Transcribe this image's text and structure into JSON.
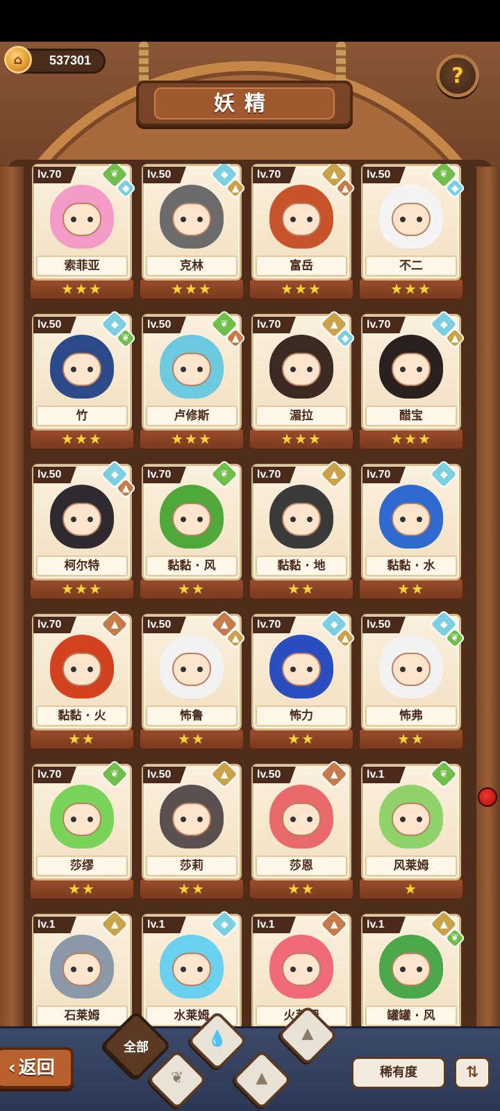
{
  "header": {
    "coins": "537301",
    "title": "妖精",
    "help_icon": "question-leaf-icon"
  },
  "colors": {
    "grass": "#6fbf4a",
    "water": "#7ccfe0",
    "earth": "#c9a24a",
    "fire": "#c57b4a",
    "wind": "#8fd36a"
  },
  "cards": [
    {
      "level": "lv.70",
      "name": "索菲亚",
      "stars": "★★★",
      "element": "grass",
      "sub": "water",
      "hair": "#f39ac6"
    },
    {
      "level": "lv.50",
      "name": "克林",
      "stars": "★★★",
      "element": "water",
      "sub": "earth",
      "hair": "#6b6b6b"
    },
    {
      "level": "lv.70",
      "name": "富岳",
      "stars": "★★★",
      "element": "earth",
      "sub": "fire",
      "hair": "#c7532a"
    },
    {
      "level": "lv.50",
      "name": "不二",
      "stars": "★★★",
      "element": "grass",
      "sub": "water",
      "hair": "#f4f4f4"
    },
    {
      "level": "lv.50",
      "name": "竹",
      "stars": "★★★",
      "element": "water",
      "sub": "grass",
      "hair": "#2c4a8a"
    },
    {
      "level": "lv.50",
      "name": "卢修斯",
      "stars": "★★★",
      "element": "grass",
      "sub": "fire",
      "hair": "#6cc9e0"
    },
    {
      "level": "lv.70",
      "name": "湄拉",
      "stars": "★★★",
      "element": "earth",
      "sub": "water",
      "hair": "#3a2a22"
    },
    {
      "level": "lv.70",
      "name": "醋宝",
      "stars": "★★★",
      "element": "water",
      "sub": "earth",
      "hair": "#2a2020"
    },
    {
      "level": "lv.50",
      "name": "柯尔特",
      "stars": "★★★",
      "element": "water",
      "sub": "fire",
      "hair": "#2e2a30"
    },
    {
      "level": "lv.70",
      "name": "黏黏 · 风",
      "stars": "★★",
      "element": "grass",
      "sub": "",
      "hair": "#4ea83a"
    },
    {
      "level": "lv.70",
      "name": "黏黏 · 地",
      "stars": "★★",
      "element": "earth",
      "sub": "",
      "hair": "#3a3a3a"
    },
    {
      "level": "lv.70",
      "name": "黏黏 · 水",
      "stars": "★★",
      "element": "water",
      "sub": "",
      "hair": "#2f6ad0"
    },
    {
      "level": "lv.70",
      "name": "黏黏 · 火",
      "stars": "★★",
      "element": "fire",
      "sub": "",
      "hair": "#d2421e"
    },
    {
      "level": "lv.50",
      "name": "怖鲁",
      "stars": "★★",
      "element": "fire",
      "sub": "earth",
      "hair": "#f2f2f2"
    },
    {
      "level": "lv.70",
      "name": "怖力",
      "stars": "★★",
      "element": "water",
      "sub": "earth",
      "hair": "#2a4ec0"
    },
    {
      "level": "lv.50",
      "name": "怖弗",
      "stars": "★★",
      "element": "water",
      "sub": "grass",
      "hair": "#f2f2f2"
    },
    {
      "level": "lv.70",
      "name": "莎缪",
      "stars": "★★",
      "element": "grass",
      "sub": "",
      "hair": "#7ad45a"
    },
    {
      "level": "lv.50",
      "name": "莎莉",
      "stars": "★★",
      "element": "earth",
      "sub": "",
      "hair": "#5a5050"
    },
    {
      "level": "lv.50",
      "name": "莎恩",
      "stars": "★★",
      "element": "fire",
      "sub": "",
      "hair": "#e86a6a"
    },
    {
      "level": "lv.1",
      "name": "风莱姆",
      "stars": "★",
      "element": "grass",
      "sub": "",
      "hair": "#8fd36a"
    },
    {
      "level": "lv.1",
      "name": "石莱姆",
      "stars": "",
      "element": "earth",
      "sub": "",
      "hair": "#8a98a8"
    },
    {
      "level": "lv.1",
      "name": "水莱姆",
      "stars": "",
      "element": "water",
      "sub": "",
      "hair": "#6ad0f0"
    },
    {
      "level": "lv.1",
      "name": "火莱姆",
      "stars": "",
      "element": "fire",
      "sub": "",
      "hair": "#f06a7a"
    },
    {
      "level": "lv.1",
      "name": "罐罐 · 风",
      "stars": "",
      "element": "earth",
      "sub": "grass",
      "hair": "#4aa84a"
    }
  ],
  "bottom": {
    "back_label": "返回",
    "filter_all": "全部",
    "filters": [
      "water-drop-icon",
      "sprout-icon",
      "mountain-icon",
      "earth-mountain-icon"
    ],
    "rarity_label": "稀有度",
    "sort_icon": "sort-icon"
  }
}
